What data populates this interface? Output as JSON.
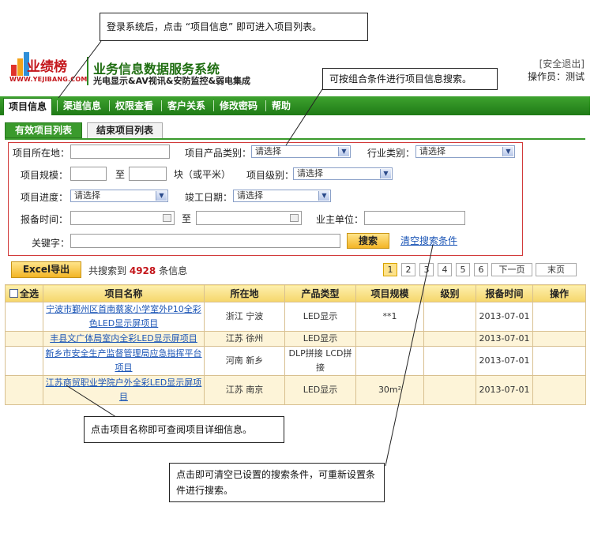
{
  "header": {
    "logo_text": "业绩榜",
    "logo_url": "WWW.YEJIBANG.COM",
    "title": "业务信息数据服务系统",
    "subtitle": "光电显示&AV视讯&安防监控&弱电集成",
    "logout": "[安全退出]",
    "operator": "操作员：测试"
  },
  "nav": [
    "项目信息",
    "渠道信息",
    "权限查看",
    "客户关系",
    "修改密码",
    "帮助"
  ],
  "tabs": [
    "有效项目列表",
    "结束项目列表"
  ],
  "search": {
    "location_label": "项目所在地：",
    "category_label": "项目产品类别：",
    "industry_label": "行业类别：",
    "scale_label": "项目规模：",
    "to": "至",
    "unit": "块（或平米）",
    "level_label": "项目级别：",
    "progress_label": "项目进度：",
    "completion_label": "竣工日期：",
    "report_label": "报备时间：",
    "owner_label": "业主单位：",
    "keyword_label": "关键字：",
    "select_placeholder": "请选择",
    "search_button": "搜索",
    "clear_link": "清空搜索条件"
  },
  "results": {
    "excel_button": "Excel导出",
    "prefix": "共搜索到",
    "count": "4928",
    "suffix": "条信息",
    "pages": [
      "1",
      "2",
      "3",
      "4",
      "5",
      "6"
    ],
    "next": "下一页",
    "last": "末页"
  },
  "table": {
    "headers": [
      "全选",
      "项目名称",
      "所在地",
      "产品类型",
      "项目规模",
      "级别",
      "报备时间",
      "操作"
    ],
    "rows": [
      {
        "name": "宁波市鄞州区首南蔡家小学室外P10全彩色LED显示屏项目",
        "location": "浙江 宁波",
        "type": "LED显示",
        "scale": "**1",
        "level": "",
        "date": "2013-07-01"
      },
      {
        "name": "丰县文广体局室内全彩LED显示屏项目",
        "location": "江苏 徐州",
        "type": "LED显示",
        "scale": "",
        "level": "",
        "date": "2013-07-01"
      },
      {
        "name": "新乡市安全生产监督管理局应急指挥平台项目",
        "location": "河南 新乡",
        "type": "DLP拼接 LCD拼接",
        "scale": "",
        "level": "",
        "date": "2013-07-01"
      },
      {
        "name": "江苏商贸职业学院户外全彩LED显示屏项目",
        "location": "江苏 南京",
        "type": "LED显示",
        "scale": "30m²",
        "level": "",
        "date": "2013-07-01"
      }
    ]
  },
  "callouts": {
    "login": "登录系统后，点击 “项目信息” 即可进入项目列表。",
    "combo": "可按组合条件进行项目信息搜索。",
    "detail": "点击项目名称即可查阅项目详细信息。",
    "clear": "点击即可清空已设置的搜索条件，可重新设置条件进行搜索。"
  },
  "colors": {
    "nav_green": "#2a8c20",
    "brand_red": "#c4171c",
    "search_border": "#d23a3a",
    "link_blue": "#1b55b6"
  }
}
